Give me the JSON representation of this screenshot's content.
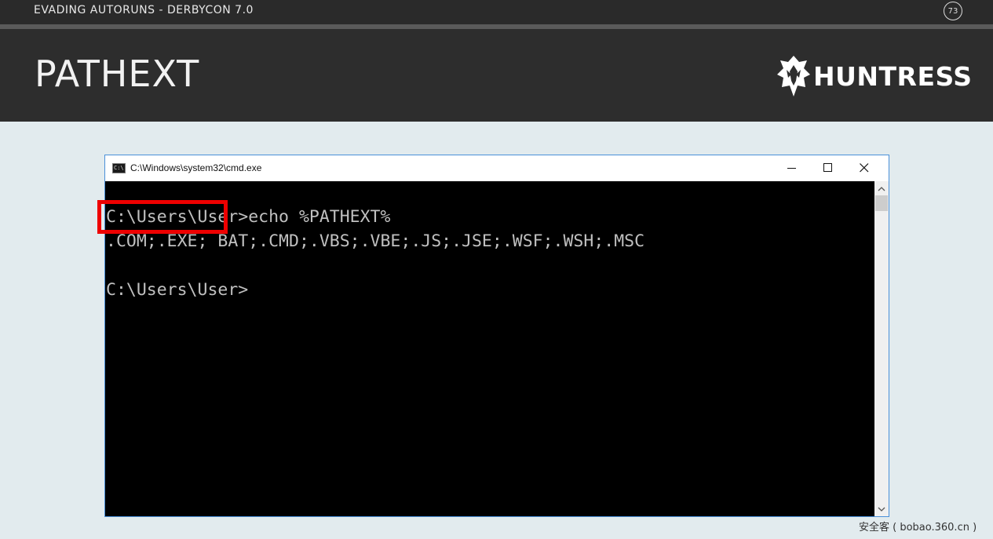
{
  "slide": {
    "deck_title": "EVADING AUTORUNS - DERBYCON 7.0",
    "slide_number": "73",
    "title": "PATHEXT",
    "logo_text": "HUNTRESS"
  },
  "window": {
    "title": "C:\\Windows\\system32\\cmd.exe",
    "icon": "cmd-icon",
    "icon_text": "C:\\",
    "buttons": {
      "minimize": "minimize-icon",
      "maximize": "maximize-icon",
      "close": "close-icon"
    }
  },
  "console": {
    "lines": [
      "C:\\Users\\User>echo %PATHEXT%",
      ".COM;.EXE; BAT;.CMD;.VBS;.VBE;.JS;.JSE;.WSF;.WSH;.MSC",
      "C:\\Users\\User>"
    ],
    "highlighted_text": ".COM;.EXE;",
    "highlight_color": "#ee0000",
    "text_color": "#c0c0c0",
    "background_color": "#000000"
  },
  "watermark": "安全客 ( bobao.360.cn )"
}
